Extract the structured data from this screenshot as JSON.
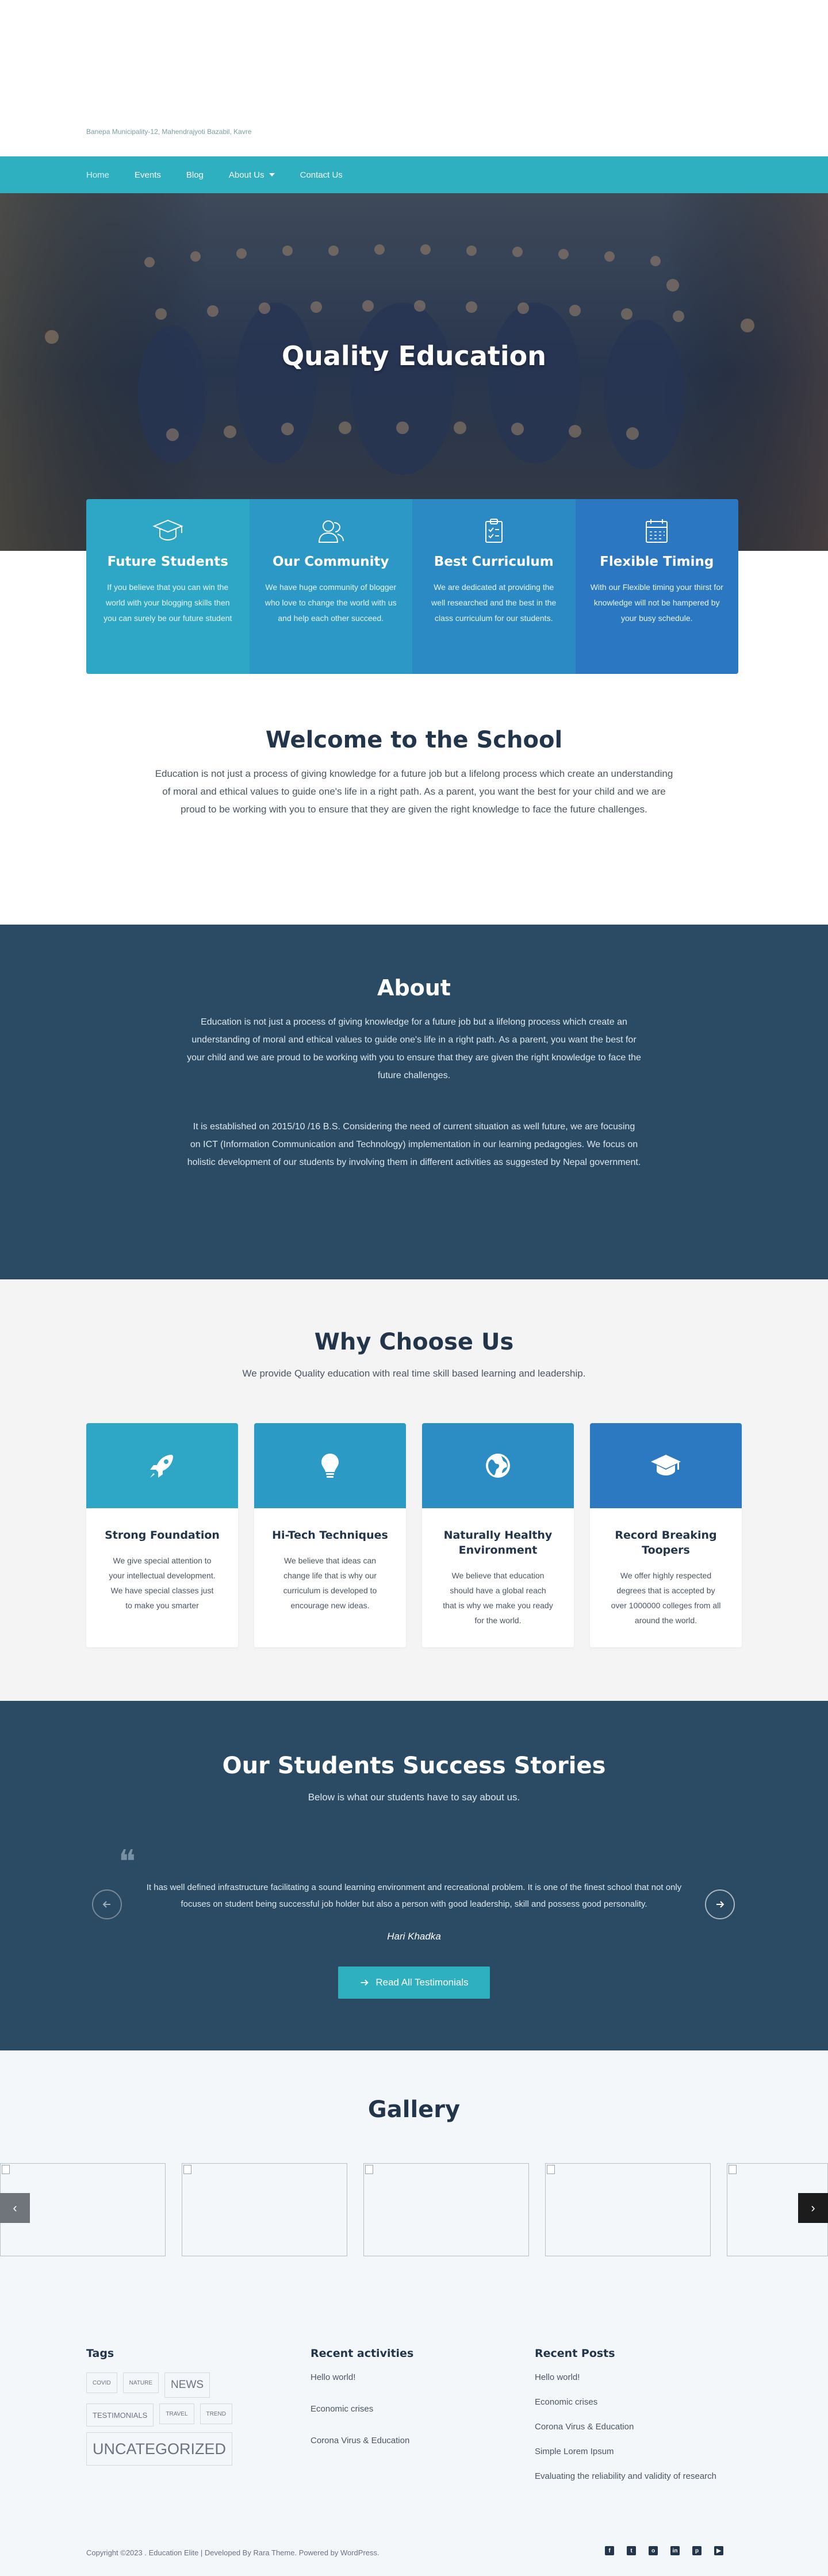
{
  "header": {
    "address": "Banepa Municipality-12, Mahendrajyoti Bazabil, Kavre"
  },
  "nav": {
    "items": [
      {
        "label": "Home"
      },
      {
        "label": "Events"
      },
      {
        "label": "Blog"
      },
      {
        "label": "About Us"
      },
      {
        "label": "Contact Us"
      }
    ]
  },
  "hero": {
    "title": "Quality Education"
  },
  "features": [
    {
      "title": "Future Students",
      "text": "If you believe that you can win the world with your blogging skills then you can surely be our future student",
      "icon": "graduation-cap-icon",
      "color": "#2ea7c6"
    },
    {
      "title": "Our Community",
      "text": "We have huge community of blogger who love to change the world with us and help each other succeed.",
      "icon": "community-icon",
      "color": "#2b98c5"
    },
    {
      "title": "Best Curriculum",
      "text": "We are dedicated at providing the well researched and the best in the class curriculum for our students.",
      "icon": "curriculum-icon",
      "color": "#2b89c4"
    },
    {
      "title": "Flexible Timing",
      "text": "With our Flexible timing your thirst for knowledge will not be hampered by your busy schedule.",
      "icon": "calendar-icon",
      "color": "#2c77c2"
    }
  ],
  "welcome": {
    "title": "Welcome to the School",
    "text": "Education is not just a process of giving knowledge for a future job but a lifelong process which create an understanding of moral and ethical values to guide one's life in a right path. As a parent, you want the best for your child and we are proud to be working with you to ensure that they are given the right knowledge to face the future challenges."
  },
  "about": {
    "title": "About",
    "para1": "Education is not just a process of giving knowledge for a future job but a lifelong process which create an understanding of moral and ethical values to guide one's life in a right path. As a parent, you want the best for your child and we are proud to be working with you to ensure that they are given the right knowledge to face the future challenges.",
    "para2": "It is established on 2015/10 /16 B.S. Considering the need of current situation as well future, we are focusing on ICT (Information Communication and Technology) implementation in our learning pedagogies. We focus on holistic development of our students by involving them in different activities as suggested by Nepal government."
  },
  "why": {
    "title": "Why Choose Us",
    "subtitle": "We provide Quality education with real time skill based learning and leadership.",
    "cards": [
      {
        "title": "Strong Foundation",
        "text": "We give special attention to your intellectual development. We have special classes just to make you smarter",
        "icon": "rocket-icon",
        "color": "#2ea7c6"
      },
      {
        "title": "Hi-Tech Techniques",
        "text": "We believe that ideas can change life that is why our curriculum is developed to encourage new ideas.",
        "icon": "lightbulb-icon",
        "color": "#2b9bc5"
      },
      {
        "title": "Naturally Healthy Environment",
        "text": "We believe that education should have a global reach that is why we make you ready for the world.",
        "icon": "globe-icon",
        "color": "#2b8dc4"
      },
      {
        "title": "Record Breaking Toopers",
        "text": "We offer highly respected degrees that is accepted by over 1000000 colleges from all around the world.",
        "icon": "mortarboard-icon",
        "color": "#2c79c2"
      }
    ]
  },
  "testimonials": {
    "title": "Our Students Success Stories",
    "subtitle": "Below is what our students have to say about us.",
    "quote": "It has well defined infrastructure facilitating a sound learning environment and recreational problem. It is one of the finest school that not only focuses on student being successful job holder but also a person with good leadership, skill and possess good personality.",
    "author": "Hari Khadka",
    "button": "Read All Testimonials"
  },
  "gallery": {
    "title": "Gallery"
  },
  "footer": {
    "tags_title": "Tags",
    "tags": [
      {
        "label": "covid",
        "size": 10
      },
      {
        "label": "nature",
        "size": 10
      },
      {
        "label": "news",
        "size": 19
      },
      {
        "label": "testimonials",
        "size": 13
      },
      {
        "label": "travel",
        "size": 10
      },
      {
        "label": "trend",
        "size": 10
      },
      {
        "label": "uncategorized",
        "size": 27
      }
    ],
    "activities_title": "Recent activities",
    "activities": [
      "Hello world!",
      "Economic crises",
      "Corona Virus & Education"
    ],
    "posts_title": "Recent Posts",
    "posts": [
      "Hello world!",
      "Economic crises",
      "Corona Virus & Education",
      "Simple Lorem Ipsum",
      "Evaluating the reliability and validity of research"
    ],
    "copyright": "Copyright ©2023 . Education Elite | Developed By Rara Theme. Powered by WordPress.",
    "social": [
      {
        "icon": "facebook-icon",
        "glyph": "f"
      },
      {
        "icon": "twitter-icon",
        "glyph": "t"
      },
      {
        "icon": "instagram-icon",
        "glyph": "o"
      },
      {
        "icon": "linkedin-icon",
        "glyph": "in"
      },
      {
        "icon": "pinterest-icon",
        "glyph": "p"
      },
      {
        "icon": "youtube-icon",
        "glyph": "▶"
      }
    ]
  }
}
